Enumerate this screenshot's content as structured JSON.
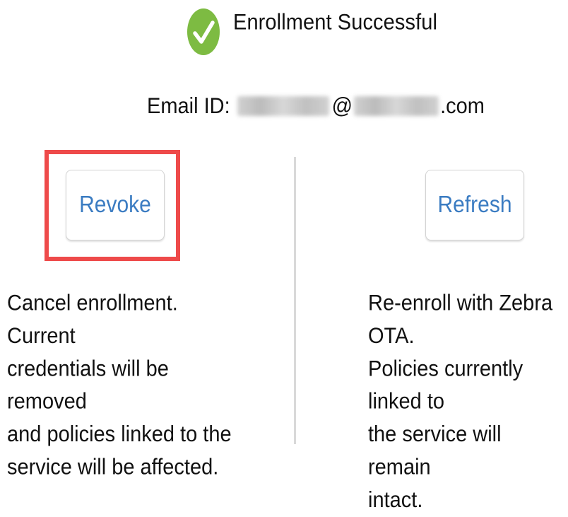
{
  "header": {
    "status_icon": "check-circle-icon",
    "status_color": "#7dbb42",
    "title": "Enrollment Successful"
  },
  "email": {
    "label": "Email ID:",
    "at_sign": "@",
    "suffix": ".com",
    "redacted": true
  },
  "actions": {
    "revoke": {
      "label": "Revoke",
      "description": "Cancel enrollment. Current\ncredentials will be removed\nand policies linked to the\nservice will be affected.",
      "highlighted": true,
      "highlight_color": "#ee4a4a"
    },
    "refresh": {
      "label": "Refresh",
      "description": "Re-enroll with Zebra OTA.\nPolicies currently linked to\nthe service will remain\nintact."
    }
  },
  "colors": {
    "button_text": "#3b7cc2",
    "divider": "#d9d9d9"
  }
}
